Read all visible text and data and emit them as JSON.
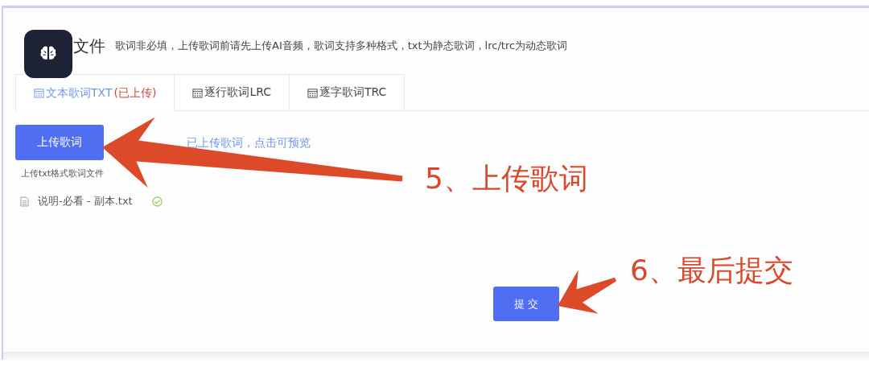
{
  "section": {
    "title": "文件",
    "description": "歌词非必填，上传歌词前请先上传AI音频，歌词支持多种格式，txt为静态歌词，lrc/trc为动态歌词"
  },
  "tabs": [
    {
      "label": "文本歌词TXT",
      "status": "(已上传)",
      "selected": true
    },
    {
      "label": "逐行歌词LRC",
      "selected": false
    },
    {
      "label": "逐字歌词TRC",
      "selected": false
    }
  ],
  "upload": {
    "button": "上传歌词",
    "preview_link": "已上传歌词，点击可预览",
    "hint": "上传txt格式歌词文件",
    "files": [
      {
        "name": "说明-必看 - 副本.txt",
        "uploaded": true
      }
    ]
  },
  "submit_button": "提 交",
  "annotations": [
    {
      "kind": "upload",
      "text": "5、上传歌词"
    },
    {
      "kind": "submit",
      "text": "6、最后提交"
    }
  ]
}
